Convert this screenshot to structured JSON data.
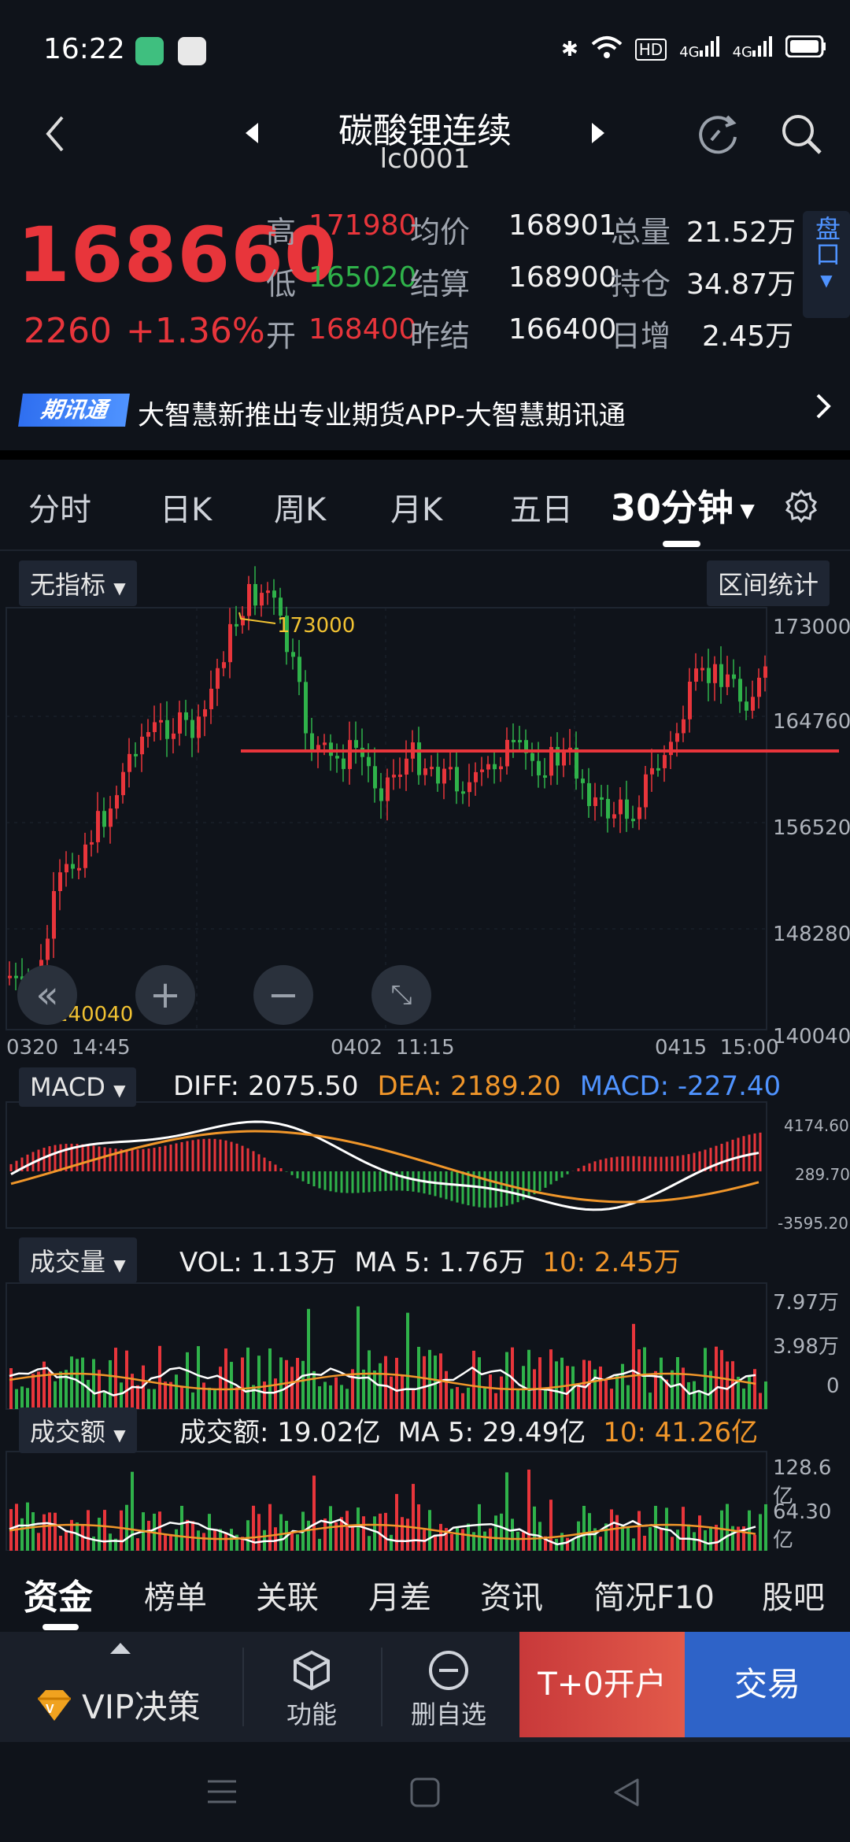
{
  "status": {
    "time": "16:22",
    "hd": "HD",
    "net1": "4G",
    "net2": "4G"
  },
  "header": {
    "title": "碳酸锂连续",
    "code": "lc0001"
  },
  "quote": {
    "price": "168660",
    "change": "2260",
    "change_pct": "+1.36%",
    "high_label": "高",
    "high": "171980",
    "low_label": "低",
    "low": "165020",
    "open_label": "开",
    "open": "168400",
    "avg_label": "均价",
    "avg": "168901",
    "settle_label": "结算",
    "settle": "168900",
    "prev_settle_label": "昨结",
    "prev_settle": "166400",
    "volume_label": "总量",
    "volume": "21.52万",
    "oi_label": "持仓",
    "oi": "34.87万",
    "daily_inc_label": "日增",
    "daily_inc": "2.45万",
    "pankou_label": "盘口"
  },
  "banner": {
    "tag": "期讯通",
    "text": "大智慧新推出专业期货APP-大智慧期讯通"
  },
  "tabs": [
    "分时",
    "日K",
    "周K",
    "月K",
    "五日",
    "30分钟"
  ],
  "chart": {
    "indicator_btn": "无指标",
    "range_stat_btn": "区间统计",
    "max_label": "173000",
    "min_label": "140040",
    "y_ticks": [
      "173000",
      "164760",
      "156520",
      "148280",
      "140040"
    ],
    "x_ticks": [
      "0320  14:45",
      "0402  11:15",
      "0415  15:00"
    ],
    "macd_btn": "MACD",
    "diff": "DIFF: 2075.50",
    "dea": "DEA: 2189.20",
    "macd": "MACD: -227.40",
    "macd_ticks": [
      "4174.60",
      "289.70",
      "-3595.20"
    ],
    "vol_btn": "成交量",
    "vol": "VOL: 1.13万",
    "vol_ma5": "MA 5: 1.76万",
    "vol_ma10": "10: 2.45万",
    "vol_ticks": [
      "7.97万",
      "3.98万",
      "0"
    ],
    "amt_btn": "成交额",
    "amt": "成交额: 19.02亿",
    "amt_ma5": "MA 5: 29.49亿",
    "amt_ma10": "10: 41.26亿",
    "amt_ticks": [
      "128.6亿",
      "64.30亿"
    ]
  },
  "bottom_tabs": [
    "资金",
    "榜单",
    "关联",
    "月差",
    "资讯",
    "简况F10",
    "股吧"
  ],
  "footer": {
    "vip": "VIP决策",
    "func": "功能",
    "remove": "删自选",
    "open_acct": "T+0开户",
    "trade": "交易"
  }
}
